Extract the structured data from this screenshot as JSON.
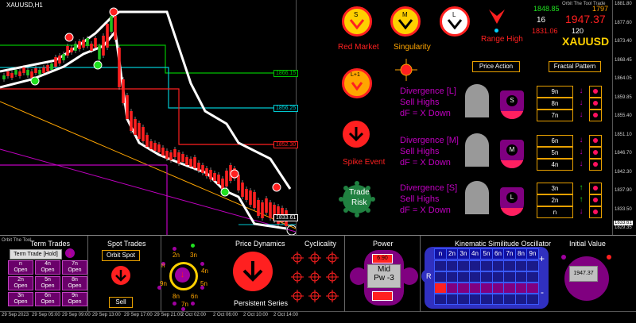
{
  "chart": {
    "symbol_title": "XAUUSD,H1",
    "price_ticks": [
      "1881.80",
      "1877.60",
      "1873.40",
      "1868.45",
      "1864.05",
      "1859.85",
      "1855.40",
      "1851.10",
      "1846.70",
      "1842.30",
      "1837.90",
      "1833.50",
      "1829.35"
    ],
    "level_labels": [
      {
        "text": "1866.15",
        "color": "#00c000"
      },
      {
        "text": "1856.25",
        "color": "#00c8d0"
      },
      {
        "text": "1852.30",
        "color": "#ff2020"
      },
      {
        "text": "1833.61",
        "color": "#ffffff"
      }
    ],
    "current_price": "1833.61",
    "time_ticks": [
      "29 Sep 2023",
      "29 Sep 05:00",
      "29 Sep 09:00",
      "29 Sep 13:00",
      "29 Sep 17:00",
      "29 Sep 21:00",
      "2 Oct 02:00",
      "2 Oct 06:00",
      "2 Oct 10:00",
      "2 Oct 14:00"
    ]
  },
  "indicators": {
    "s_label": "S",
    "m_label": "M",
    "l_label": "L",
    "lplus_label": "L+1",
    "red_market": "Red Market",
    "singularity": "Singularity",
    "range_high": "Range High",
    "spike_event": "Spike Event",
    "trade_risk_1": "Trade",
    "trade_risk_2": "Risk"
  },
  "ticker": {
    "header": "Orbit The Tool Trade",
    "left_top": "1848.85",
    "right_top": "1797",
    "mid_count": "16",
    "price": "1947.37",
    "left_bottom": "1831.06",
    "mid_bottom": "120",
    "symbol": "XAUUSD"
  },
  "panel": {
    "price_action": "Price Action",
    "fractal_pattern": "Fractal Pattern",
    "divergence": [
      {
        "title": "Divergence [L]",
        "line2": "Sell Highs",
        "line3": "dF = X Down",
        "badge": "S",
        "tf": [
          "9n",
          "8n",
          "7n"
        ],
        "arrows": [
          "↓",
          "↓",
          "↓"
        ]
      },
      {
        "title": "Divergence [M]",
        "line2": "Sell Highs",
        "line3": "dF = X Down",
        "badge": "M",
        "tf": [
          "6n",
          "5n",
          "4n"
        ],
        "arrows": [
          "↓",
          "↓",
          "↓"
        ]
      },
      {
        "title": "Divergence [S]",
        "line2": "Sell Highs",
        "line3": "dF = X Down",
        "badge": "L",
        "tf": [
          "3n",
          "2n",
          "n"
        ],
        "arrows": [
          "↑",
          "↑",
          "↓"
        ]
      }
    ]
  },
  "bottom": {
    "orbit_tool": "Orbit The Tool",
    "term_trades": "Term Trades",
    "term_trade_hold": "Term Trade [Hold]",
    "cells": [
      [
        "n\nOpen",
        "4n\nOpen",
        "7n\nOpen"
      ],
      [
        "2n\nOpen",
        "5n\nOpen",
        "8n\nOpen"
      ],
      [
        "3n\nOpen",
        "6n\nOpen",
        "9n\nOpen"
      ]
    ],
    "spot_trades": "Spot Trades",
    "orbit_spot": "Orbit Spot",
    "sell": "Sell",
    "orbit_labels": {
      "top_left": "2n",
      "top_right": "3n",
      "left": "n",
      "right": "4n",
      "mid_left": "9n",
      "mid_right": "5n",
      "bot_left": "8n",
      "bot_right": "6n",
      "bottom": "7n"
    },
    "price_dynamics": "Price Dynamics",
    "persistent_series": "Persistent Series",
    "cyclicality": "Cyclicality",
    "power": "Power",
    "power_top": "6.90",
    "power_mid_1": "Mid",
    "power_mid_2": "Pw -3",
    "power_bot": "",
    "kinematic": "Kinematic Similitude Oscillator",
    "kin_header": [
      "n",
      "2n",
      "3n",
      "4n",
      "5n",
      "6n",
      "7n",
      "8n",
      "9n"
    ],
    "kin_r": "R",
    "kin_plus": "+",
    "kin_minus": "-",
    "initial_value": "Initial Value",
    "initial_price": "1947.37"
  }
}
